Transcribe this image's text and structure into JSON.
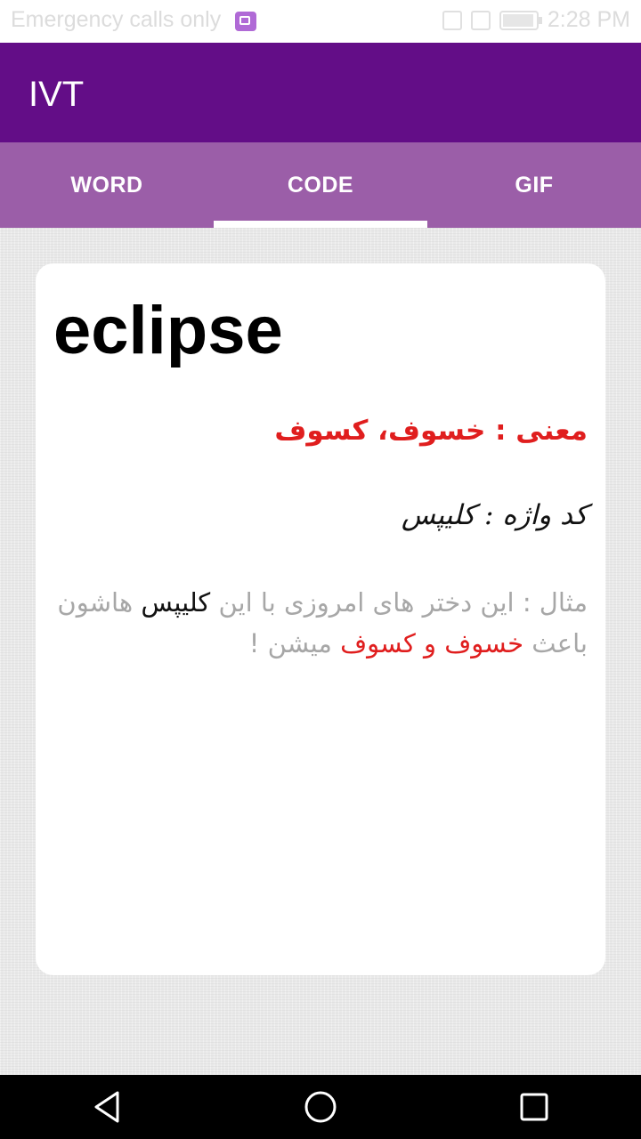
{
  "status_bar": {
    "carrier_text": "Emergency calls only",
    "time": "2:28 PM"
  },
  "app_bar": {
    "title": "IVT",
    "color": "#630d87"
  },
  "tabs": [
    {
      "label": "WORD",
      "active": false
    },
    {
      "label": "CODE",
      "active": true
    },
    {
      "label": "GIF",
      "active": false
    }
  ],
  "card": {
    "word": "eclipse",
    "meaning": "معنی : خسوف، کسوف",
    "code_word": "کد واژه : کلیپس",
    "example": {
      "part1": "مثال : این دختر های امروزی با این ",
      "keyword": "کلیپس",
      "part2": " هاشون باعث ",
      "highlight": "خسوف و کسوف",
      "part3": " میشن !"
    }
  },
  "nav_bar": {
    "icons": [
      "back-icon",
      "home-icon",
      "recents-icon"
    ]
  }
}
